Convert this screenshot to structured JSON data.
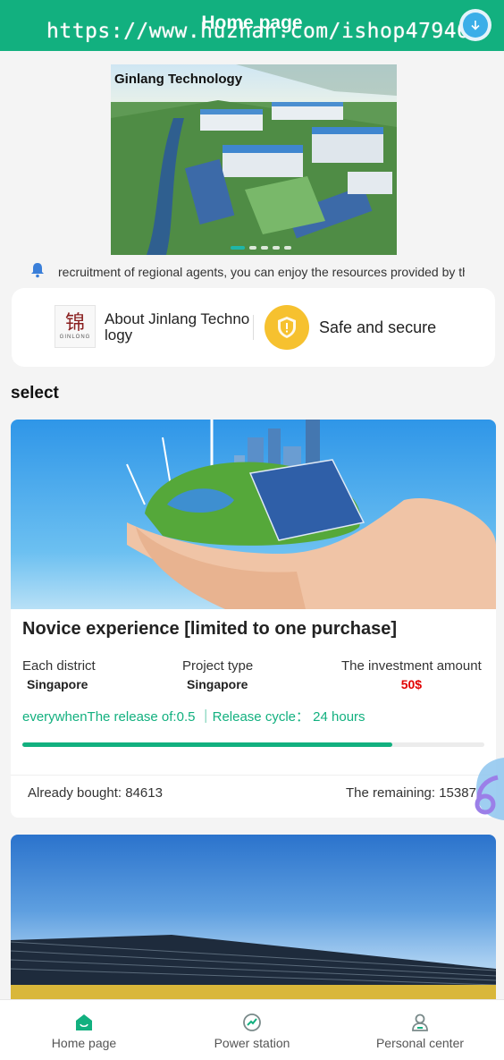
{
  "header": {
    "title": "Home page",
    "watermark": "https://www.huzhan.com/ishop47946",
    "download_icon": "download-arrow-icon"
  },
  "banner": {
    "label": "Ginlang Technology",
    "slide_count": 5,
    "active_slide": 1
  },
  "notice": {
    "icon": "bell-icon",
    "text": "recruitment of regional agents, you can enjoy the resources provided by th"
  },
  "quick_links": {
    "about_label": "About Jinlang Technology",
    "logo_text": "GINLONG",
    "safe_label": "Safe and secure"
  },
  "section_title": "select",
  "product": {
    "title": "Novice experience [limited to one purchase]",
    "district_label": "Each district",
    "district_value": "Singapore",
    "type_label": "Project type",
    "type_value": "Singapore",
    "amount_label": "The investment amount",
    "amount_value": "50$",
    "release_text": "everywhenThe release of:0.5 ｜Release cycle： 24 hours",
    "progress": 0.8,
    "bought_text": "Already bought: 84613",
    "remaining_text": "The remaining: 15387"
  },
  "nav": {
    "items": [
      {
        "label": "Home page",
        "icon": "home-icon",
        "active": true
      },
      {
        "label": "Power station",
        "icon": "chart-circle-icon",
        "active": false
      },
      {
        "label": "Personal center",
        "icon": "user-icon",
        "active": false
      }
    ]
  },
  "colors": {
    "brand": "#12b07f",
    "price": "#e10000",
    "shield": "#f6c12f"
  }
}
